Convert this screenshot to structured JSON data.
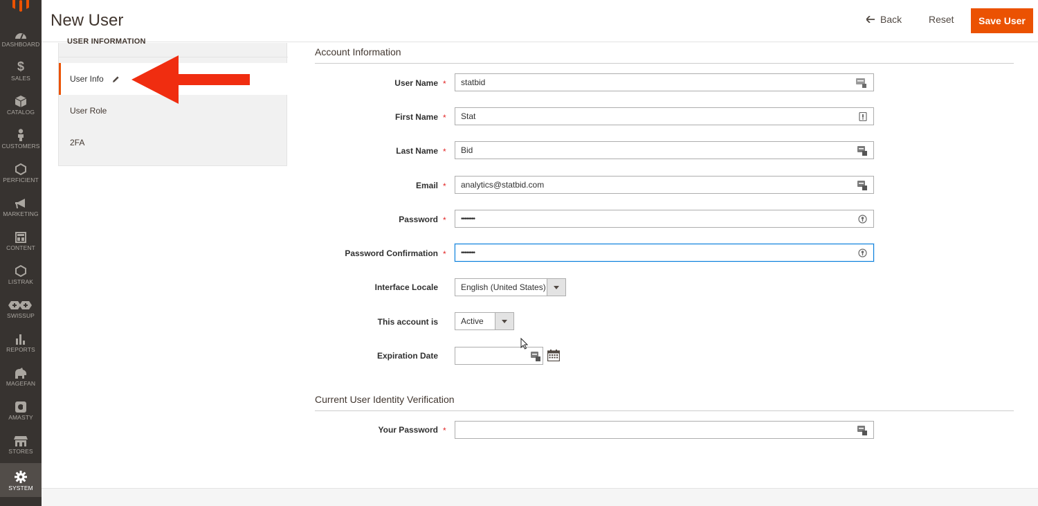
{
  "app": {
    "page_title": "New User",
    "actions": {
      "back_label": "Back",
      "reset_label": "Reset",
      "save_label": "Save User"
    },
    "accent_color": "#eb5202"
  },
  "admin_menu": {
    "items": [
      {
        "label": "DASHBOARD",
        "icon": "dashboard-icon"
      },
      {
        "label": "SALES",
        "icon": "dollar-icon"
      },
      {
        "label": "CATALOG",
        "icon": "cube-icon"
      },
      {
        "label": "CUSTOMERS",
        "icon": "person-icon"
      },
      {
        "label": "PERFICIENT",
        "icon": "hexagon-icon"
      },
      {
        "label": "MARKETING",
        "icon": "megaphone-icon"
      },
      {
        "label": "CONTENT",
        "icon": "layout-icon"
      },
      {
        "label": "LISTRAK",
        "icon": "hexagon-outline-icon"
      },
      {
        "label": "SWISSUP",
        "icon": "swissup-icon"
      },
      {
        "label": "REPORTS",
        "icon": "bar-chart-icon"
      },
      {
        "label": "MAGEFAN",
        "icon": "magefan-icon"
      },
      {
        "label": "AMASTY",
        "icon": "amasty-icon"
      },
      {
        "label": "STORES",
        "icon": "store-icon"
      },
      {
        "label": "SYSTEM",
        "icon": "gear-icon"
      }
    ]
  },
  "sidebar_tabs": {
    "heading": "USER INFORMATION",
    "tabs": [
      {
        "label": "User Info",
        "active": true
      },
      {
        "label": "User Role",
        "active": false
      },
      {
        "label": "2FA",
        "active": false
      }
    ]
  },
  "account_info": {
    "title": "Account Information",
    "fields": {
      "username": {
        "label": "User Name",
        "value": "statbid",
        "required": true
      },
      "firstname": {
        "label": "First Name",
        "value": "Stat",
        "required": true
      },
      "lastname": {
        "label": "Last Name",
        "value": "Bid",
        "required": true
      },
      "email": {
        "label": "Email",
        "value": "analytics@statbid.com",
        "required": true
      },
      "password": {
        "label": "Password",
        "value": "••••••••",
        "required": true
      },
      "password_confirmation": {
        "label": "Password Confirmation",
        "value": "••••••••",
        "required": true
      },
      "interface_locale": {
        "label": "Interface Locale",
        "value": "English (United States)"
      },
      "account_status": {
        "label": "This account is",
        "value": "Active"
      },
      "expiration_date": {
        "label": "Expiration Date",
        "value": ""
      }
    }
  },
  "identity_verification": {
    "title": "Current User Identity Verification",
    "fields": {
      "your_password": {
        "label": "Your Password",
        "value": "",
        "required": true
      }
    }
  },
  "required_marker": "*"
}
